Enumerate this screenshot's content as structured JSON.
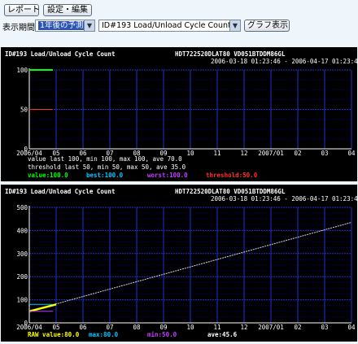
{
  "toolbar": {
    "report_label": "レポート",
    "settings_label": "設定・編集",
    "period_label": "表示期間",
    "period_value": "1年後の予測",
    "item_value": "ID#193 Load/Unload Cycle Count",
    "graph_label": "グラフ表示"
  },
  "colors": {
    "panel_bg": "#000000",
    "grid_minor": "#00008b",
    "grid_major": "#1f2fd0",
    "value": "#00ff00",
    "best": "#00c8ff",
    "worst": "#c040ff",
    "threshold": "#ff3030",
    "raw": "#ffff00",
    "trend": "#d8d8d8"
  },
  "chart1": {
    "title": "ID#193 Load/Unload Cycle Count",
    "device": "HDT722520DLAT80  VD051BTDDM86GL",
    "range": "2006-03-18 01:23:46 - 2006-04-17 01:23:46",
    "stats_value": "value     last 100, min 100, max 100, ave  70.0",
    "stats_threshold": "threshold last  50, min  50, max  50, ave  35.0",
    "legend": {
      "value": "value:100.0",
      "best": "best:100.0",
      "worst": "worst:100.0",
      "threshold": "threshold:50.0"
    }
  },
  "chart2": {
    "title": "ID#193 Load/Unload Cycle Count",
    "device": "HDT722520DLAT80  VD051BTDDM86GL",
    "range": "2006-03-18 01:23:46 - 2006-04-17 01:23:46",
    "legend": {
      "raw": "RAW value:80.0",
      "max": "max:80.0",
      "min": "min:50.0",
      "ave": "ave:45.6"
    }
  },
  "chart_data": [
    {
      "type": "line",
      "x_ticks": [
        "2006/04",
        "05",
        "06",
        "07",
        "08",
        "09",
        "10",
        "11",
        "12",
        "2007/01",
        "02",
        "03",
        "04"
      ],
      "ylim": [
        0,
        100
      ],
      "y_ticks": [
        0,
        50,
        100
      ],
      "grid": true,
      "series": [
        {
          "name": "value",
          "x_range": [
            "2006/04",
            "05"
          ],
          "y": 100
        },
        {
          "name": "threshold",
          "x_range": [
            "2006/04",
            "05"
          ],
          "y": 50
        }
      ]
    },
    {
      "type": "line",
      "x_ticks": [
        "2006/04",
        "05",
        "06",
        "07",
        "08",
        "09",
        "10",
        "11",
        "12",
        "2007/01",
        "02",
        "03",
        "04"
      ],
      "ylim": [
        0,
        500
      ],
      "y_ticks": [
        0,
        100,
        200,
        300,
        400,
        500
      ],
      "grid": true,
      "series": [
        {
          "name": "RAW value",
          "x": [
            "2006/04",
            "05"
          ],
          "y": [
            50,
            80
          ]
        },
        {
          "x": [
            "2006/04",
            "04"
          ],
          "y": [
            50,
            435
          ]
        }
      ]
    }
  ]
}
